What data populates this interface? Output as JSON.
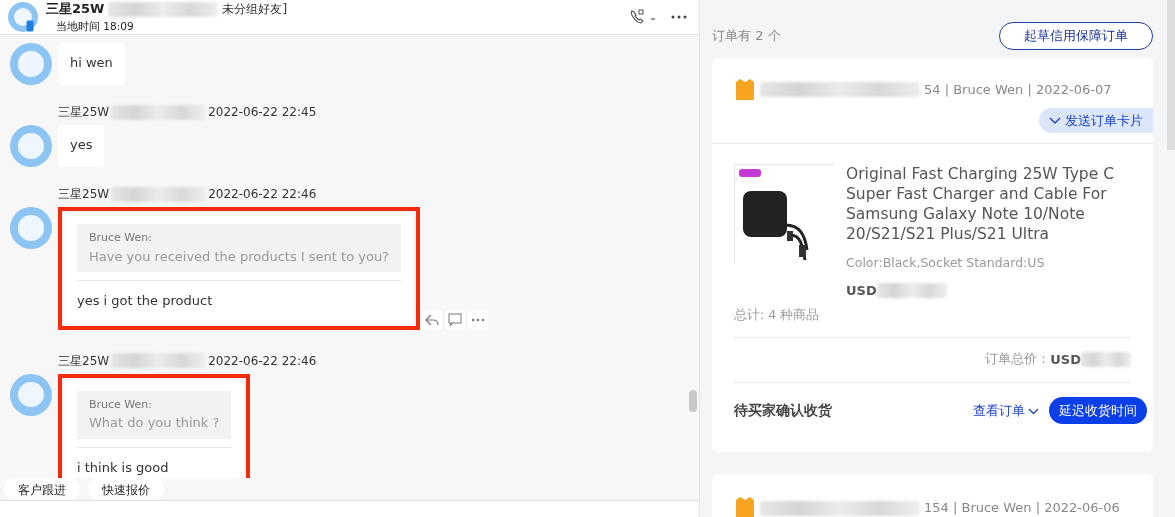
{
  "chat_header": {
    "name_prefix": "三星25W",
    "group": "未分组好友]",
    "local_time": "当地时间 18:09"
  },
  "messages": [
    {
      "kind": "text",
      "body": "hi wen",
      "highlighted": false,
      "actions": false
    },
    {
      "kind": "text",
      "sender": "三星25W",
      "time": "2022-06-22 22:45",
      "body": "yes",
      "highlighted": false,
      "actions": false
    },
    {
      "kind": "quote",
      "sender": "三星25W",
      "time": "2022-06-22 22:46",
      "quote_author": "Bruce Wen:",
      "quote_text": "Have you received the products I sent to you?",
      "body": "yes i got the product",
      "highlighted": true,
      "actions": true
    },
    {
      "kind": "quote",
      "sender": "三星25W",
      "time": "2022-06-22 22:46",
      "quote_author": "Bruce Wen:",
      "quote_text": "What do you think ?",
      "body": "i think is good",
      "highlighted": true,
      "actions": false
    }
  ],
  "bottom_tabs": [
    "客户跟进",
    "快速报价"
  ],
  "orders_panel": {
    "count_label": "订单有 2 个",
    "draft_button": "起草信用保障订单",
    "orders": [
      {
        "meta": "54 | Bruce Wen | 2022-06-07",
        "send_card": "发送订单卡片",
        "product_title": "Original Fast Charging 25W Type C Super Fast Charger and Cable For Samsung Galaxy Note 10/Note 20/S21/S21 Plus/S21 Ultra",
        "variant": "Color:Black,Socket Standard:US",
        "price_currency": "USD",
        "total_items": "总计: 4 种商品",
        "total_label": "订单总价：",
        "total_currency": "USD",
        "status": "待买家确认收货",
        "view_link": "查看订单",
        "extend_button": "延迟收货时间"
      },
      {
        "meta": "154 | Bruce Wen | 2022-06-06"
      }
    ]
  }
}
